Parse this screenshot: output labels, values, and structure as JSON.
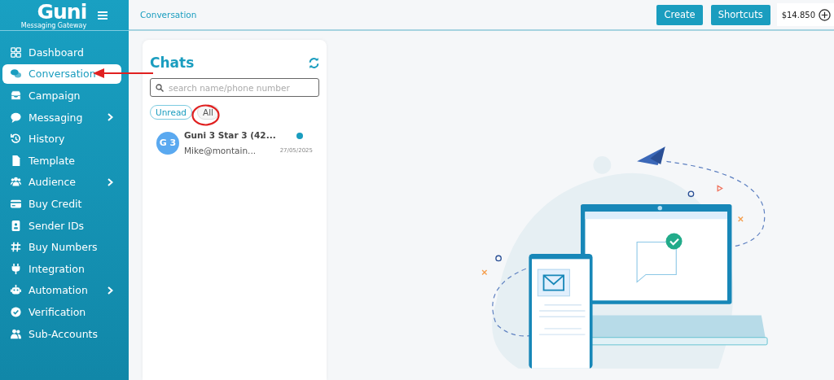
{
  "logo": {
    "name": "Guni",
    "tagline": "Messaging Gateway"
  },
  "sidebar": {
    "items": [
      {
        "label": "Dashboard",
        "selected": false,
        "has_submenu": false
      },
      {
        "label": "Conversation",
        "selected": true,
        "has_submenu": false
      },
      {
        "label": "Campaign",
        "selected": false,
        "has_submenu": false
      },
      {
        "label": "Messaging",
        "selected": false,
        "has_submenu": true
      },
      {
        "label": "History",
        "selected": false,
        "has_submenu": false
      },
      {
        "label": "Template",
        "selected": false,
        "has_submenu": false
      },
      {
        "label": "Audience",
        "selected": false,
        "has_submenu": true
      },
      {
        "label": "Buy Credit",
        "selected": false,
        "has_submenu": false
      },
      {
        "label": "Sender IDs",
        "selected": false,
        "has_submenu": false
      },
      {
        "label": "Buy Numbers",
        "selected": false,
        "has_submenu": false
      },
      {
        "label": "Integration",
        "selected": false,
        "has_submenu": false
      },
      {
        "label": "Automation",
        "selected": false,
        "has_submenu": true
      },
      {
        "label": "Verification",
        "selected": false,
        "has_submenu": false
      },
      {
        "label": "Sub-Accounts",
        "selected": false,
        "has_submenu": false
      }
    ]
  },
  "topbar": {
    "breadcrumb": "Conversation",
    "buttons": [
      "Create",
      "Shortcuts"
    ],
    "balance": "$14.850"
  },
  "chats": {
    "title": "Chats",
    "search": {
      "placeholder": "search name/phone number"
    },
    "filters": [
      {
        "label": "Unread",
        "selected": false
      },
      {
        "label": "All",
        "selected": true
      }
    ],
    "items": [
      {
        "avatar": "G 3",
        "name": "Guni 3 Star 3 (42...",
        "preview": "Mike@montain...",
        "date": "27/05/2025",
        "unread": true
      }
    ]
  }
}
